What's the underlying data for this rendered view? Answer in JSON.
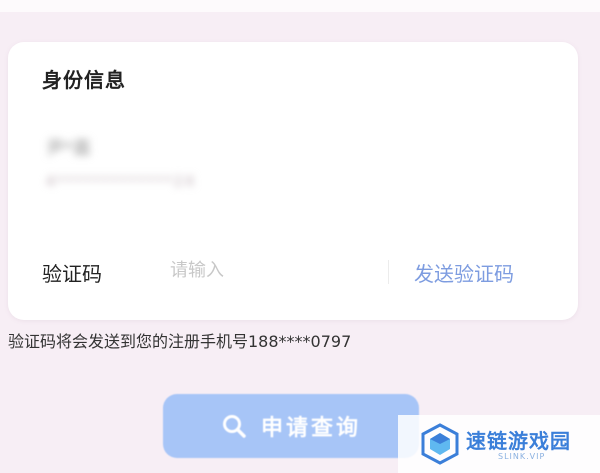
{
  "card": {
    "title": "身份信息",
    "name_masked": "尹*嘉",
    "id_masked": "4*************2X",
    "verify_label": "验证码",
    "verify_placeholder": "请输入",
    "send_code_label": "发送验证码"
  },
  "hint": "验证码将会发送到您的注册手机号188****0797",
  "query_button": {
    "label": "申请查询",
    "icon": "search-icon"
  },
  "watermark": {
    "text": "速链游戏园",
    "sub": "SLINK.VIP",
    "icon": "logo-icon"
  },
  "colors": {
    "background": "#f7eef5",
    "accent_link": "#7d9ce0",
    "button": "#a7c5f7",
    "watermark": "#3b7fd9"
  }
}
